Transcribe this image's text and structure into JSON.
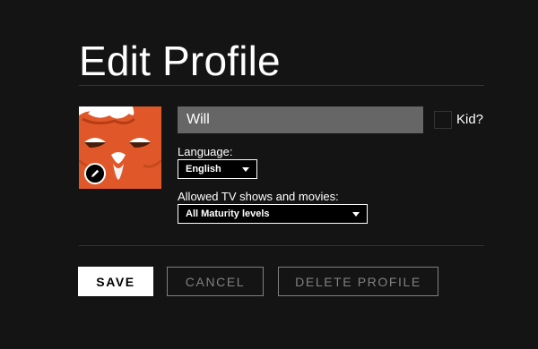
{
  "page": {
    "title": "Edit Profile"
  },
  "profile": {
    "name_value": "Will",
    "kid_label": "Kid?",
    "kid_checked": false,
    "avatar_icon": "orange-cartoon-face-avatar",
    "edit_icon": "pencil-icon"
  },
  "language": {
    "label": "Language:",
    "selected": "English"
  },
  "maturity": {
    "label": "Allowed TV shows and movies:",
    "selected": "All Maturity levels"
  },
  "actions": {
    "save_label": "SAVE",
    "cancel_label": "CANCEL",
    "delete_label": "DELETE PROFILE"
  },
  "colors": {
    "background": "#141414",
    "avatar": "#e0582a",
    "input_fill": "#666666",
    "muted_button": "#808080"
  }
}
